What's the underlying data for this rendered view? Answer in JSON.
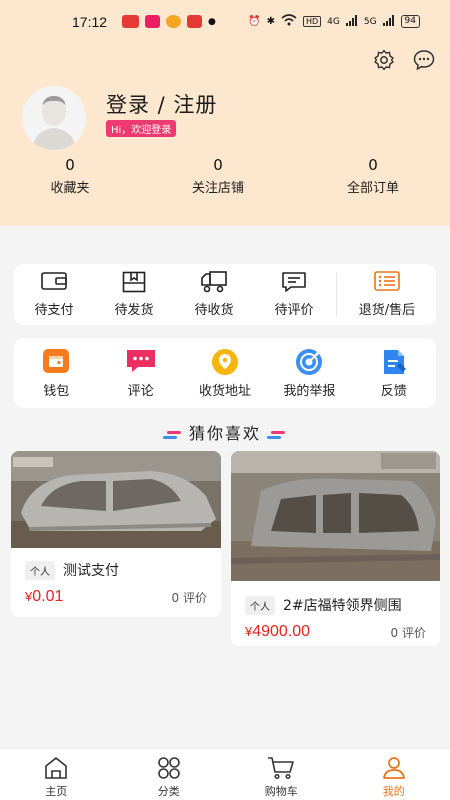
{
  "status_bar": {
    "time": "17:12",
    "battery": "94",
    "network": "HD",
    "signal1": "4G",
    "signal2": "5G"
  },
  "header": {
    "login_title": "登录 / 注册",
    "welcome": "Hi，欢迎登录",
    "stats": [
      {
        "value": "0",
        "label": "收藏夹"
      },
      {
        "value": "0",
        "label": "关注店铺"
      },
      {
        "value": "0",
        "label": "全部订单"
      }
    ],
    "icons": [
      "settings-icon",
      "message-icon"
    ]
  },
  "orders": [
    {
      "label": "待支付",
      "icon": "wallet-icon"
    },
    {
      "label": "待发货",
      "icon": "package-icon"
    },
    {
      "label": "待收货",
      "icon": "truck-icon"
    },
    {
      "label": "待评价",
      "icon": "comment-icon"
    },
    {
      "label": "退货/售后",
      "icon": "return-icon"
    }
  ],
  "tools": [
    {
      "label": "钱包",
      "icon": "wallet-icon"
    },
    {
      "label": "评论",
      "icon": "chat-icon"
    },
    {
      "label": "收货地址",
      "icon": "location-icon"
    },
    {
      "label": "我的举报",
      "icon": "report-icon"
    },
    {
      "label": "反馈",
      "icon": "feedback-icon"
    }
  ],
  "guess_title": "猜你喜欢",
  "products": [
    {
      "tag": "个人",
      "title": "测试支付",
      "price": "0.01",
      "currency": "¥",
      "reviews": "0 评价"
    },
    {
      "tag": "个人",
      "title": "2#店福特领界侧围",
      "price": "4900.00",
      "currency": "¥",
      "reviews": "0 评价"
    }
  ],
  "tabbar": [
    {
      "label": "主页",
      "icon": "home-icon",
      "active": false
    },
    {
      "label": "分类",
      "icon": "category-icon",
      "active": false
    },
    {
      "label": "购物车",
      "icon": "cart-icon",
      "active": false
    },
    {
      "label": "我的",
      "icon": "user-icon",
      "active": true
    }
  ],
  "colors": {
    "header_bg": "#fde7cf",
    "accent": "#e8741c",
    "price": "#e1251b",
    "badge": "#ee3a73"
  }
}
